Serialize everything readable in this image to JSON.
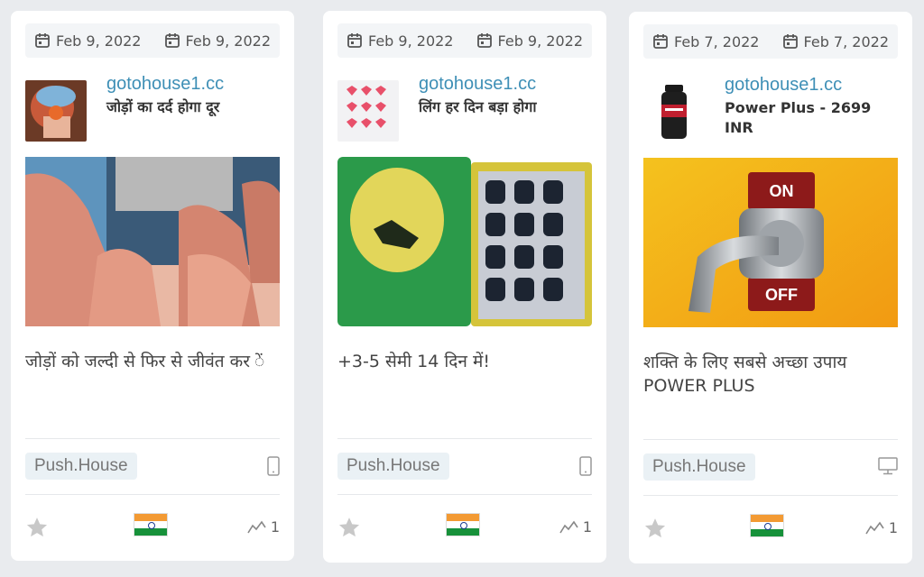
{
  "cards": [
    {
      "date_first": "Feb 9, 2022",
      "date_last": "Feb 9, 2022",
      "domain": "gotohouse1.cc",
      "subtitle": "जोड़ों का दर्द होगा दूर",
      "description": "जोड़ों को जल्दी से फिर से जीवंत कर ें",
      "source": "Push.House",
      "device": "mobile",
      "country": "India",
      "trend_count": "1"
    },
    {
      "date_first": "Feb 9, 2022",
      "date_last": "Feb 9, 2022",
      "domain": "gotohouse1.cc",
      "subtitle": "लिंग हर दिन बड़ा होगा",
      "description": "+3-5 सेमी 14 दिन में!",
      "source": "Push.House",
      "device": "mobile",
      "country": "India",
      "trend_count": "1"
    },
    {
      "date_first": "Feb 7, 2022",
      "date_last": "Feb 7, 2022",
      "domain": "gotohouse1.cc",
      "subtitle": "Power Plus - 2699 INR",
      "description": "शक्ति के लिए सबसे अच्छा उपाय POWER PLUS",
      "source": "Push.House",
      "device": "desktop",
      "country": "India",
      "trend_count": "1",
      "switch_on": "ON",
      "switch_off": "OFF"
    }
  ],
  "colors": {
    "domain": "#3e8fb6",
    "source_bg": "#eaf1f5",
    "star": "#c8c8c8"
  }
}
